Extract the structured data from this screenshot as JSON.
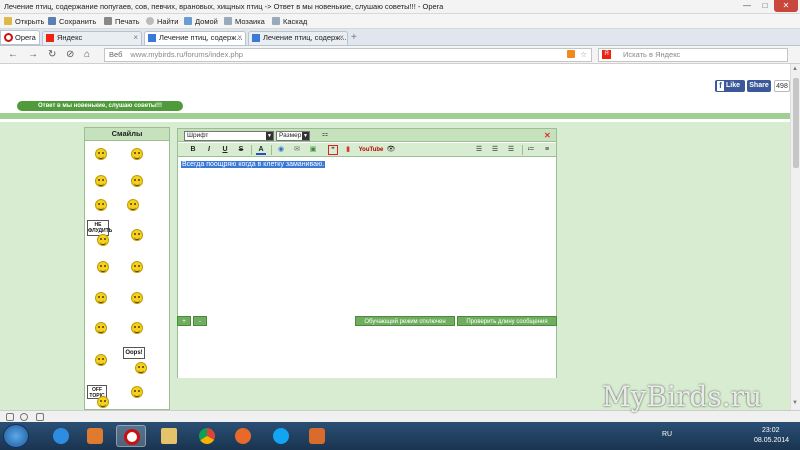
{
  "window": {
    "title": "Лечение птиц, содержание попугаев, сов, певчих, врановых, хищных птиц -> Ответ в мы новенькие, слушаю советы!!! - Opera",
    "min": "—",
    "max": "□",
    "close": "✕"
  },
  "menu": {
    "items": [
      {
        "label": "Открыть",
        "icon": "folder-icon"
      },
      {
        "label": "Сохранить",
        "icon": "save-icon"
      },
      {
        "label": "Печать",
        "icon": "print-icon"
      },
      {
        "label": "Найти",
        "icon": "search-icon"
      },
      {
        "label": "Домой",
        "icon": "home-icon"
      },
      {
        "label": "Мозаика",
        "icon": "tile-icon"
      },
      {
        "label": "Каскад",
        "icon": "cascade-icon"
      }
    ]
  },
  "tabs": {
    "opera": "Opera",
    "items": [
      {
        "label": "Яндекс",
        "active": false
      },
      {
        "label": "Лечение птиц, содерж...",
        "active": true
      },
      {
        "label": "Лечение птиц, содерж...",
        "active": false
      }
    ],
    "new_tab": "+"
  },
  "nav": {
    "web_label": "Веб",
    "url": "www.mybirds.ru/forums/index.php",
    "search_placeholder": "Искать в Яндекс",
    "back": "←",
    "forward": "→",
    "reload": "↻",
    "stop": "⊘"
  },
  "page": {
    "fb_like": "Like",
    "fb_share": "Share",
    "fb_count": "498",
    "reply_button": "Ответ в мы новенькие, слушаю советы!!!",
    "smileys_title": "Смайлы",
    "signs": [
      "НЕ ФЛУДИТЬ",
      "Oops!",
      "OFF TOPIC"
    ]
  },
  "editor": {
    "font_select": "Шрифт",
    "size_select": "Размер",
    "close": "✕",
    "bold": "B",
    "italic": "I",
    "underline": "U",
    "strike": "S",
    "font_color": "A",
    "youtube_label": "YouTube",
    "text": "Всегда поощряю когда в клетку заманиваю.",
    "plus": "+",
    "minus": "-",
    "mode_button": "Обучающий режим отключен",
    "check_button": "Проверить длину сообщения"
  },
  "taskbar": {
    "lang": "RU",
    "time": "23:02",
    "date": "08.05.2014"
  },
  "watermark": "MyBirds.ru",
  "colors": {
    "green_dark": "#4f9a3a",
    "green_light": "#d7ecd0",
    "green_header": "#c6e2bd",
    "facebook": "#3b5998",
    "selection": "#3c78d8"
  }
}
